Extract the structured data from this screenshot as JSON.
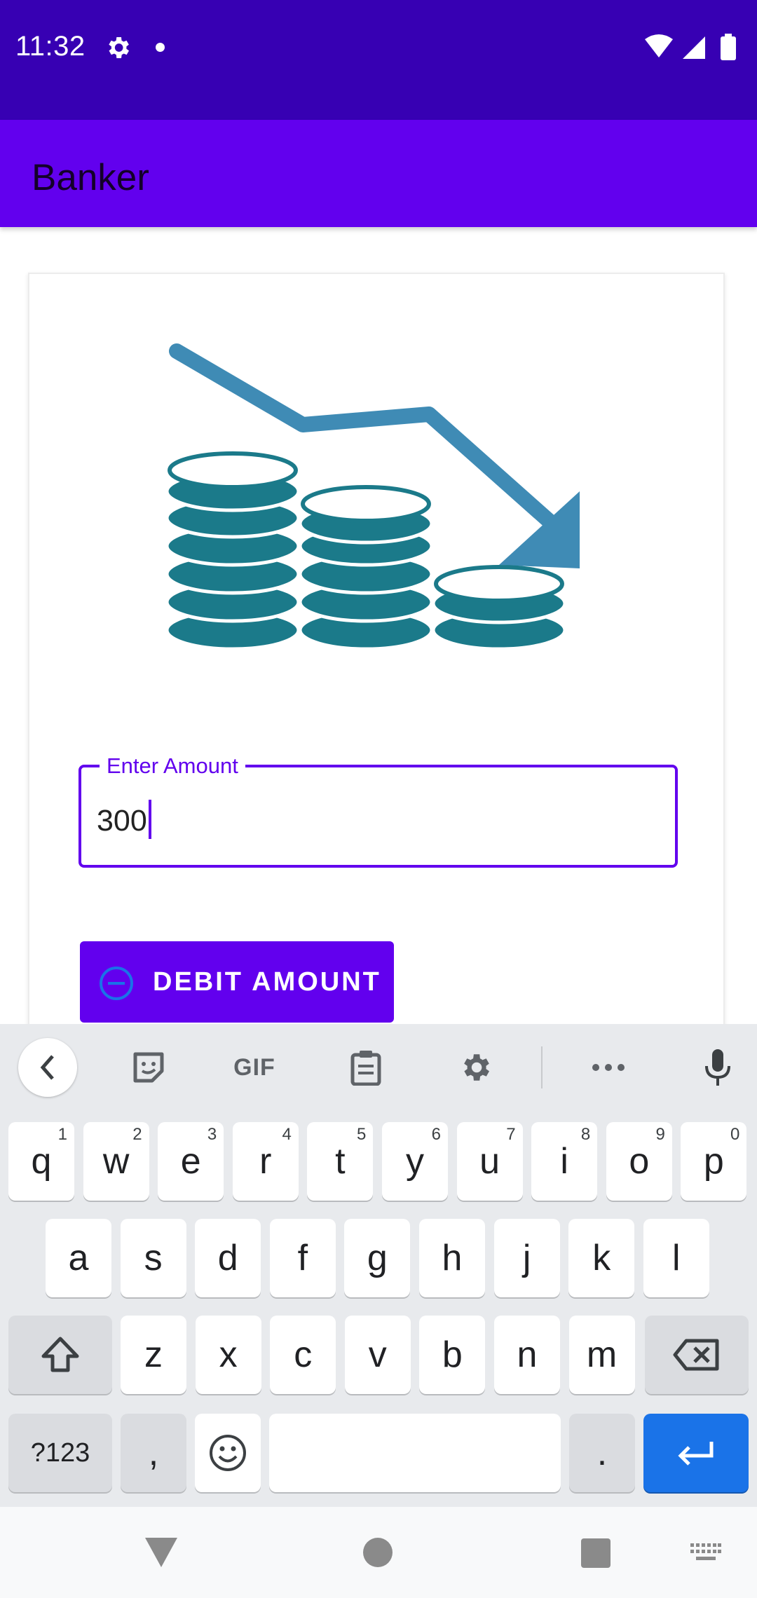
{
  "status_bar": {
    "time": "11:32",
    "icons": [
      "gear-icon",
      "notification-dot-icon",
      "wifi-icon",
      "signal-icon",
      "battery-icon"
    ]
  },
  "app_bar": {
    "title": "Banker"
  },
  "card": {
    "illustration": "coins-decreasing-chart-icon",
    "amount_field": {
      "label": "Enter Amount",
      "value": "300"
    },
    "debit_button": {
      "label": "DEBIT AMOUNT",
      "icon": "minus-circle-icon"
    }
  },
  "keyboard": {
    "toolbar": {
      "items": [
        "back-icon",
        "sticker-icon",
        "GIF",
        "clipboard-icon",
        "settings-icon",
        "more-icon",
        "mic-icon"
      ],
      "gif_label": "GIF"
    },
    "row1": [
      {
        "key": "q",
        "hint": "1"
      },
      {
        "key": "w",
        "hint": "2"
      },
      {
        "key": "e",
        "hint": "3"
      },
      {
        "key": "r",
        "hint": "4"
      },
      {
        "key": "t",
        "hint": "5"
      },
      {
        "key": "y",
        "hint": "6"
      },
      {
        "key": "u",
        "hint": "7"
      },
      {
        "key": "i",
        "hint": "8"
      },
      {
        "key": "o",
        "hint": "9"
      },
      {
        "key": "p",
        "hint": "0"
      }
    ],
    "row2": [
      "a",
      "s",
      "d",
      "f",
      "g",
      "h",
      "j",
      "k",
      "l"
    ],
    "row3": [
      "z",
      "x",
      "c",
      "v",
      "b",
      "n",
      "m"
    ],
    "row4": {
      "symbols": "?123",
      "comma": ",",
      "period": "."
    },
    "colors": {
      "accent": "#1a73e8",
      "background": "#e8eaed"
    }
  },
  "nav_bar": {
    "icons": [
      "back-triangle-icon",
      "home-circle-icon",
      "recents-square-icon",
      "keyboard-switch-icon"
    ]
  },
  "colors": {
    "primary": "#6200ee",
    "primary_dark": "#3700b3",
    "illustration_teal": "#1b7a8a",
    "illustration_arrow": "#3f8bb5"
  }
}
